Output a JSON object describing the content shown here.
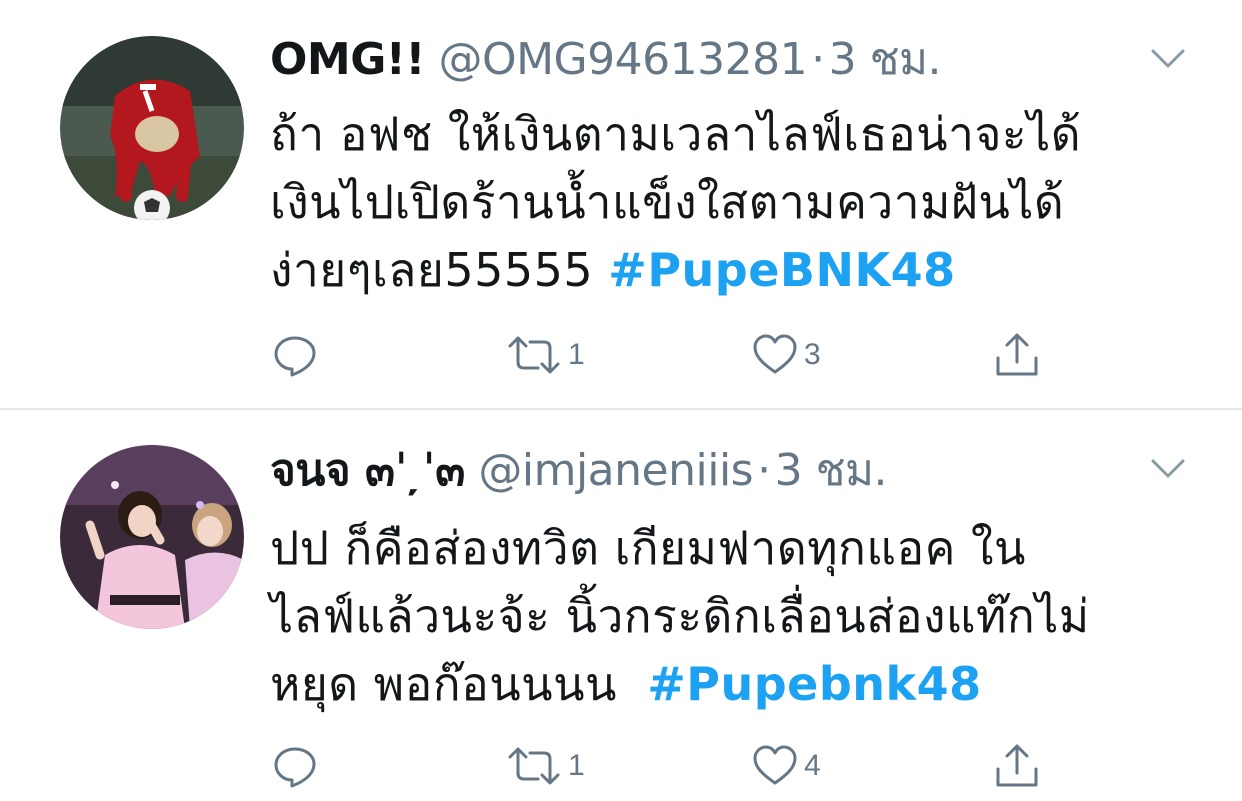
{
  "tweets": [
    {
      "display_name": "OMG!!",
      "handle": "@OMG94613281",
      "separator": "·",
      "time": "3 ชม.",
      "body_lines": [
        "ถ้า อฟช ให้เงินตามเวลาไลฟ์เธอน่าจะได้",
        "เงินไปเปิดร้านน้ำแข็งใสตามความฝันได้"
      ],
      "body_last_prefix": "ง่ายๆเลย55555 ",
      "hashtag": "#PupeBNK48",
      "reply_count": "",
      "retweet_count": "1",
      "like_count": "3",
      "avatar_icon": "avatar-football-player"
    },
    {
      "display_name": "จนจ ๓ˈ ̦ˈ๓",
      "handle": "@imjaneniiis",
      "separator": "·",
      "time": "3 ชม.",
      "body_lines": [
        "ปป ก็คือส่องทวิต เกียมฟาดทุกแอค ใน",
        "ไลฟ์แล้วนะจ้ะ นิ้วกระดิกเลื่อนส่องแท๊กไม่"
      ],
      "body_last_prefix": "หยุด พอก๊อนนนน  ",
      "hashtag": "#Pupebnk48",
      "reply_count": "",
      "retweet_count": "1",
      "like_count": "4",
      "avatar_icon": "avatar-idol-performers"
    }
  ],
  "icons": {
    "reply": "reply-icon",
    "retweet": "retweet-icon",
    "like": "heart-icon",
    "share": "share-icon",
    "menu": "chevron-down-icon"
  },
  "colors": {
    "hashtag": "#1da1f2",
    "secondary_text": "#657786",
    "primary_text": "#14171a",
    "divider": "#e1e8ed",
    "icon": "#657786"
  }
}
